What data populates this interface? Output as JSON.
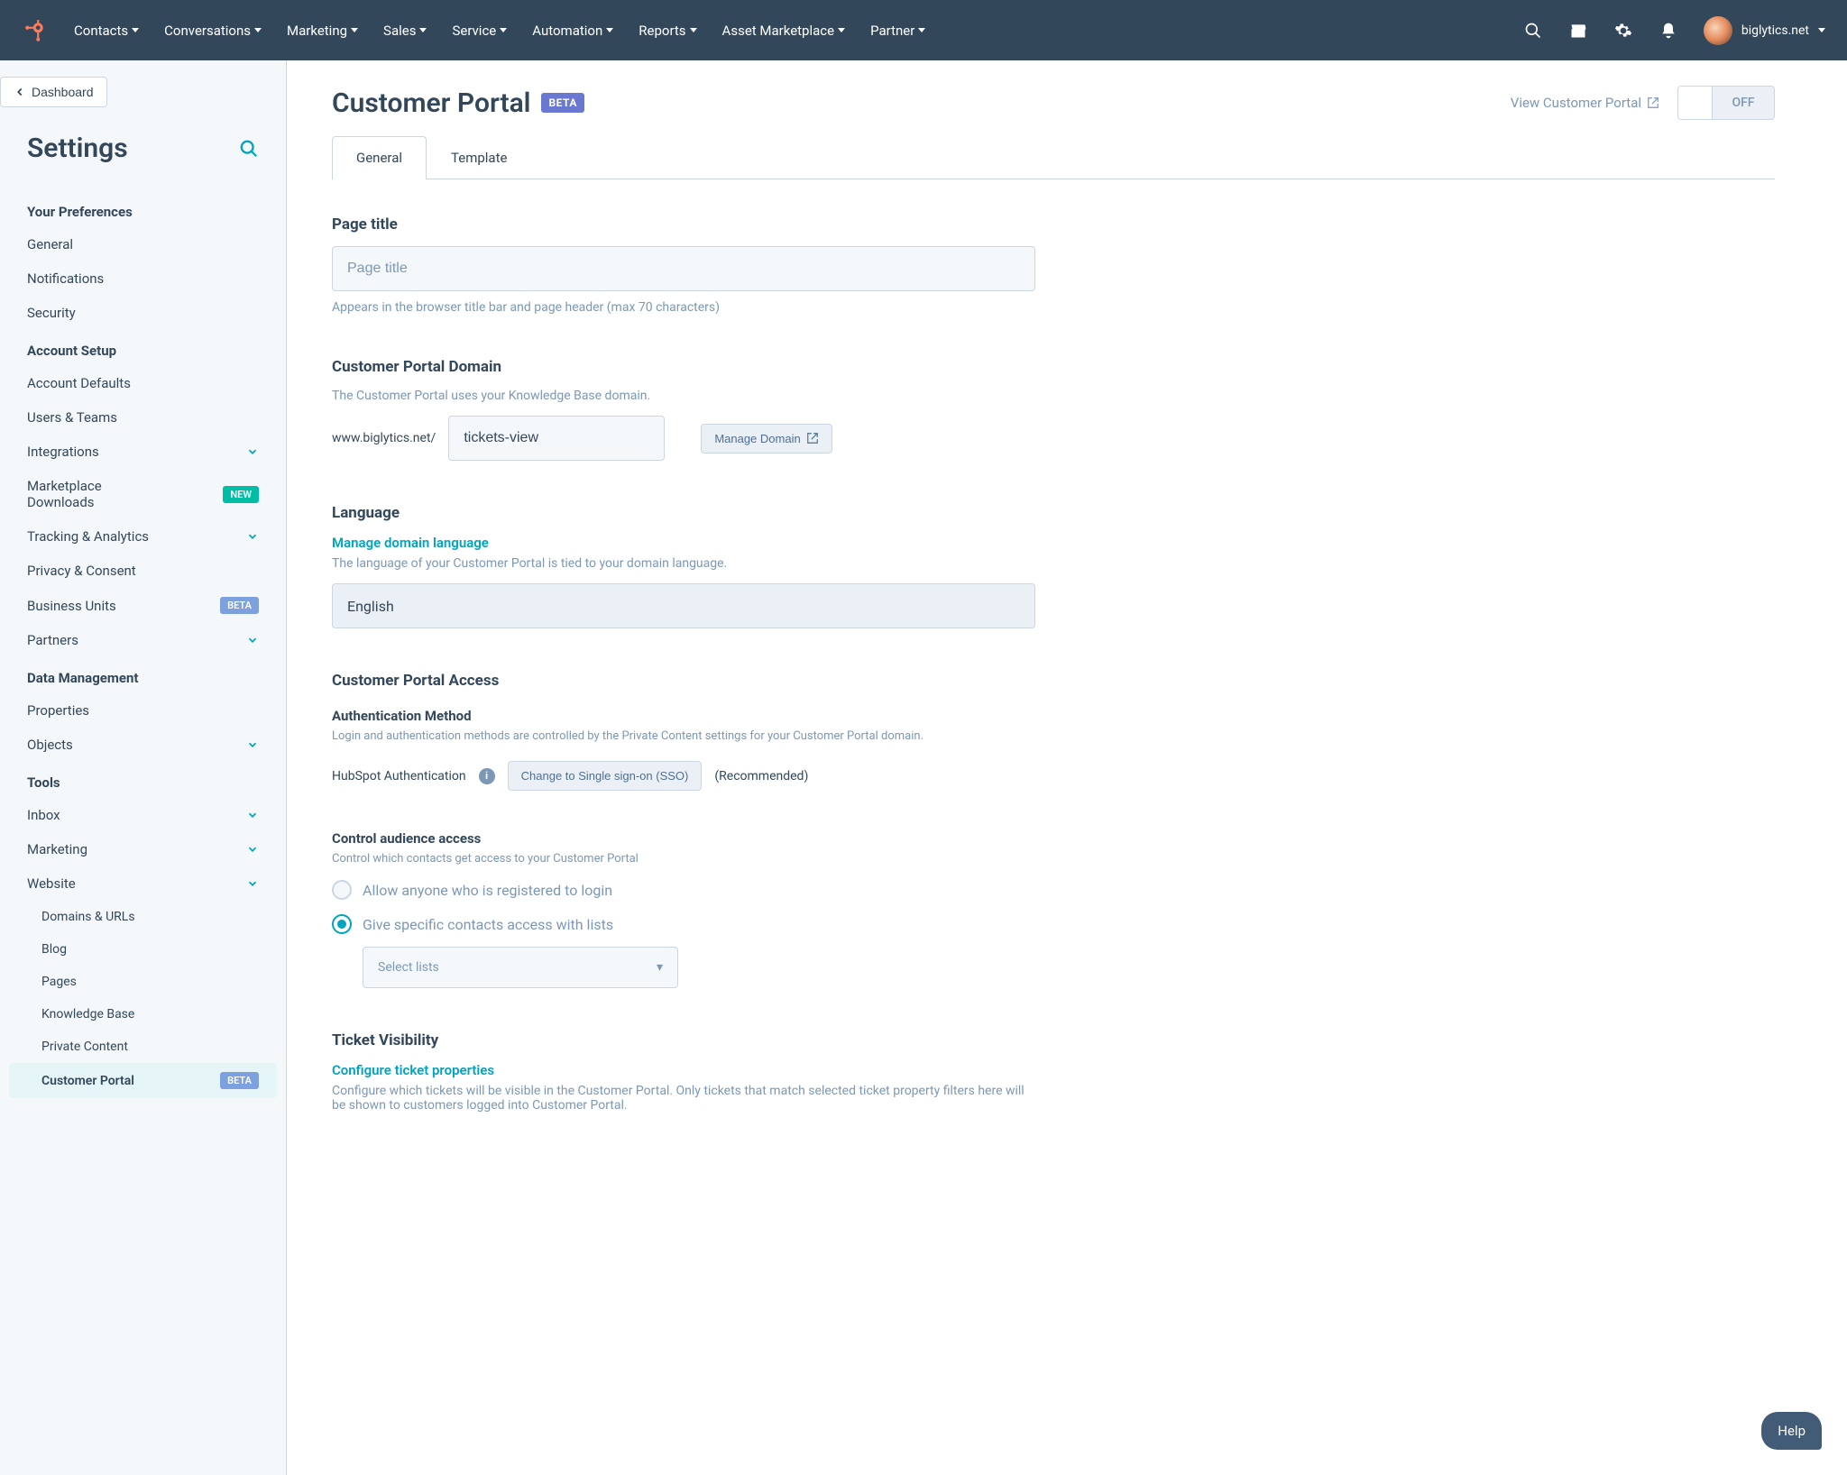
{
  "nav": {
    "items": [
      "Contacts",
      "Conversations",
      "Marketing",
      "Sales",
      "Service",
      "Automation",
      "Reports",
      "Asset Marketplace",
      "Partner"
    ],
    "account": "biglytics.net"
  },
  "sidebar": {
    "back": "Dashboard",
    "title": "Settings",
    "groups": [
      {
        "title": "Your Preferences",
        "items": [
          {
            "label": "General"
          },
          {
            "label": "Notifications"
          },
          {
            "label": "Security"
          }
        ]
      },
      {
        "title": "Account Setup",
        "items": [
          {
            "label": "Account Defaults"
          },
          {
            "label": "Users & Teams"
          },
          {
            "label": "Integrations",
            "expandable": true
          },
          {
            "label": "Marketplace Downloads",
            "badge": "NEW"
          },
          {
            "label": "Tracking & Analytics",
            "expandable": true
          },
          {
            "label": "Privacy & Consent"
          },
          {
            "label": "Business Units",
            "badge": "BETA"
          },
          {
            "label": "Partners",
            "expandable": true
          }
        ]
      },
      {
        "title": "Data Management",
        "items": [
          {
            "label": "Properties"
          },
          {
            "label": "Objects",
            "expandable": true
          }
        ]
      },
      {
        "title": "Tools",
        "items": [
          {
            "label": "Inbox",
            "expandable": true
          },
          {
            "label": "Marketing",
            "expandable": true
          },
          {
            "label": "Website",
            "expandable": true,
            "expanded": true,
            "children": [
              {
                "label": "Domains & URLs"
              },
              {
                "label": "Blog"
              },
              {
                "label": "Pages"
              },
              {
                "label": "Knowledge Base"
              },
              {
                "label": "Private Content"
              },
              {
                "label": "Customer Portal",
                "badge": "BETA",
                "active": true
              }
            ]
          }
        ]
      }
    ]
  },
  "page": {
    "title": "Customer Portal",
    "beta": "BETA",
    "viewLink": "View Customer Portal",
    "toggle": "OFF",
    "tabs": {
      "general": "General",
      "template": "Template"
    },
    "pageTitle": {
      "label": "Page title",
      "placeholder": "Page title",
      "help": "Appears in the browser title bar and page header (max 70 characters)"
    },
    "domain": {
      "label": "Customer Portal Domain",
      "help": "The Customer Portal uses your Knowledge Base domain.",
      "prefix": "www.biglytics.net/",
      "value": "tickets-view",
      "manage": "Manage Domain"
    },
    "language": {
      "label": "Language",
      "link": "Manage domain language",
      "help": "The language of your Customer Portal is tied to your domain language.",
      "value": "English"
    },
    "access": {
      "label": "Customer Portal Access",
      "auth": {
        "label": "Authentication Method",
        "help": "Login and authentication methods are controlled by the Private Content settings for your Customer Portal domain.",
        "current": "HubSpot Authentication",
        "button": "Change to Single sign-on (SSO)",
        "recommended": "(Recommended)"
      },
      "audience": {
        "label": "Control audience access",
        "help": "Control which contacts get access to your Customer Portal",
        "option1": "Allow anyone who is registered to login",
        "option2": "Give specific contacts access with lists",
        "selectPlaceholder": "Select lists"
      }
    },
    "visibility": {
      "label": "Ticket Visibility",
      "link": "Configure ticket properties",
      "help": "Configure which tickets will be visible in the Customer Portal. Only tickets that match selected ticket property filters here will be shown to customers logged into Customer Portal."
    }
  },
  "helpFab": "Help"
}
